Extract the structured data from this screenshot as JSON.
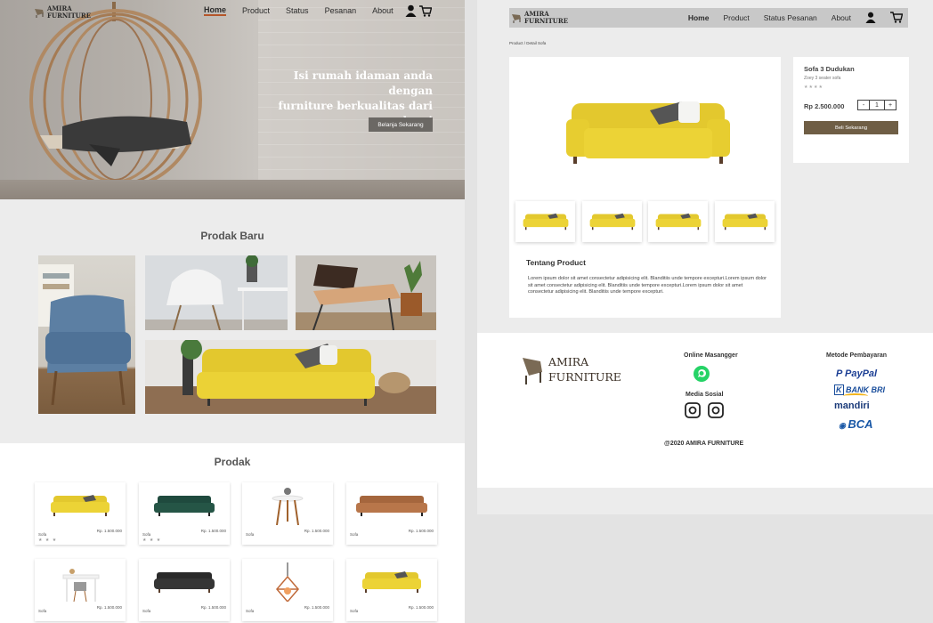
{
  "brand": {
    "line1": "AMIRA",
    "line2": "FURNITURE"
  },
  "home": {
    "nav": [
      "Home",
      "Product",
      "Status",
      "Pesanan",
      "About"
    ],
    "hero_title_1": "Isi rumah idaman anda dengan",
    "hero_title_2": "furniture berkualitas dari kami",
    "hero_button": "Belanja Sekarang",
    "new_section_title": "Prodak Baru",
    "products_section_title": "Prodak",
    "products": [
      {
        "name": "Sofa",
        "price": "Rp. 1.500.000",
        "rating": "★ ★ ★",
        "image": "yellow-sofa"
      },
      {
        "name": "Sofa",
        "price": "Rp. 1.500.000",
        "rating": "★ ★   ★",
        "image": "green-sofa"
      },
      {
        "name": "Sofa",
        "price": "Rp. 1.500.000",
        "rating": "",
        "image": "side-table"
      },
      {
        "name": "Sofa",
        "price": "Rp. 1.500.000",
        "rating": "",
        "image": "brown-sofa"
      },
      {
        "name": "Sofa",
        "price": "Rp. 1.500.000",
        "rating": "",
        "image": "white-table"
      },
      {
        "name": "Sofa",
        "price": "Rp. 1.500.000",
        "rating": "",
        "image": "chesterfield-sofa"
      },
      {
        "name": "Sofa",
        "price": "Rp. 1.500.000",
        "rating": "",
        "image": "pendant-lamp"
      },
      {
        "name": "Sofa",
        "price": "Rp. 1.500.000",
        "rating": "",
        "image": "yellow-sofa"
      }
    ]
  },
  "detail": {
    "nav": [
      "Home",
      "Product",
      "Status Pesanan",
      "About"
    ],
    "breadcrumb": "Product / Detail Sofa",
    "product_title": "Sofa 3 Dudukan",
    "product_subtitle": "Zoey 3 seater sofa",
    "rating": "★★★★",
    "price": "Rp 2.500.000",
    "qty_minus": "-",
    "qty_value": "1",
    "qty_plus": "+",
    "buy_button": "Beli Sekarang",
    "about_title": "Tentang Product",
    "about_text": "Lorem ipsum dolor sit amet consectetur adipisicing elit. Blanditiis unde tempore excepturi.Lorem ipsum dolor sit amet consectetur adipisicing elit. Blanditiis unde tempore excepturi.Lorem ipsum dolor sit amet consectetur adipisicing elit. Blanditiis unde tempore excepturi."
  },
  "footer": {
    "messenger_title": "Online Masangger",
    "social_title": "Media Sosial",
    "payment_title": "Metode Pembayaran",
    "payments": [
      "PayPal",
      "BANK BRI",
      "mandiri",
      "BCA"
    ],
    "copyright": "@2020 AMIRA FURNITURE"
  },
  "colors": {
    "accent": "#6f5e45",
    "sofa_yellow": "#e9d23a",
    "nav_underline": "#b5562a"
  }
}
